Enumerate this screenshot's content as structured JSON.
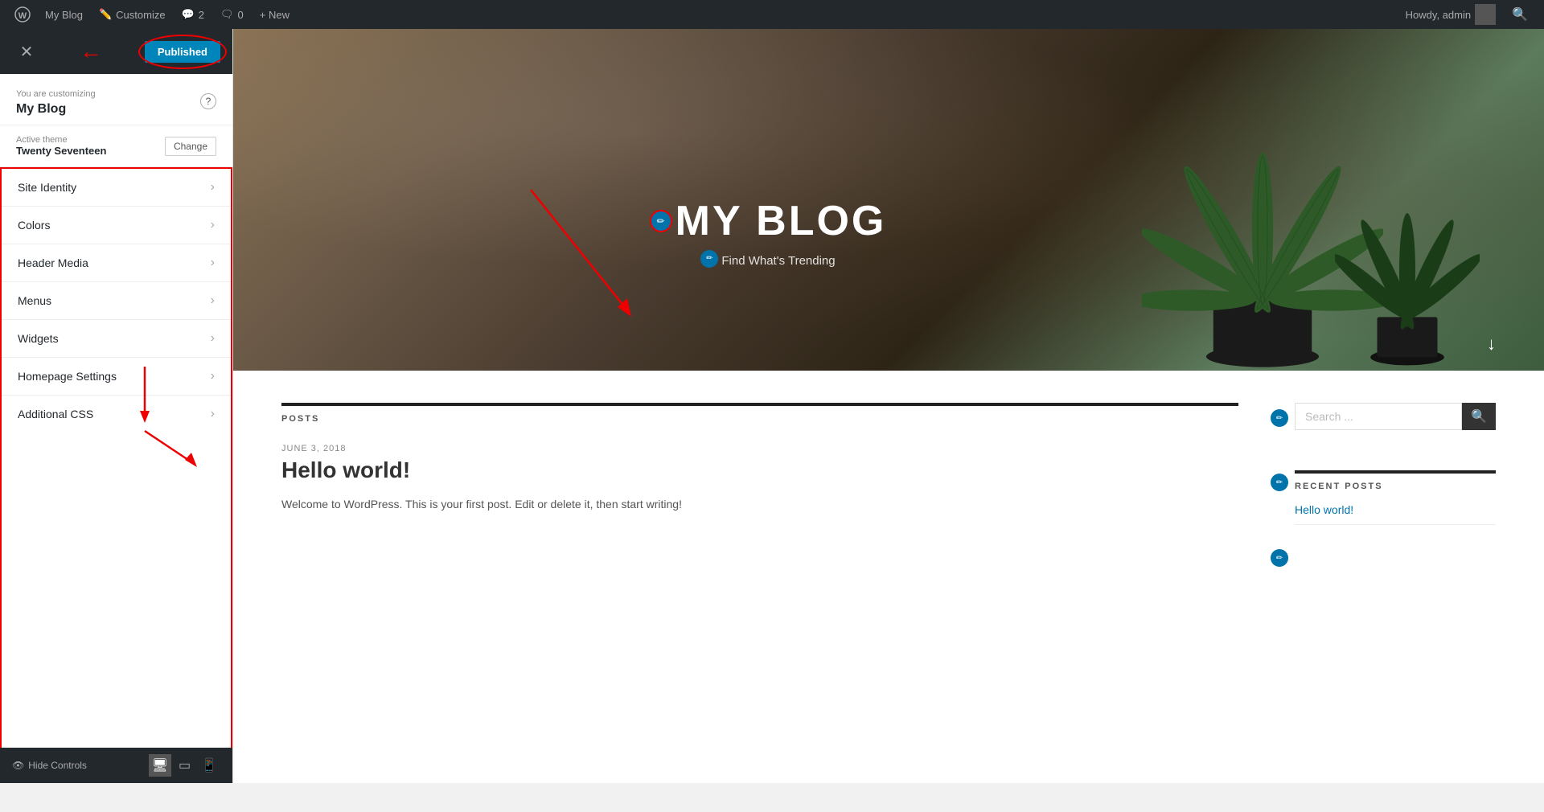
{
  "adminBar": {
    "wpLogo": "WP",
    "myBlog": "My Blog",
    "customize": "Customize",
    "comments": "2",
    "newItem": "+ New",
    "commentsCount": "0",
    "howdy": "Howdy, admin"
  },
  "customizer": {
    "youAreCustomizing": "You are customizing",
    "blogTitle": "My Blog",
    "activeThemeLabel": "Active theme",
    "themeName": "Twenty Seventeen",
    "changeBtn": "Change",
    "publishBtn": "Published",
    "menuItems": [
      {
        "label": "Site Identity",
        "id": "site-identity"
      },
      {
        "label": "Colors",
        "id": "colors"
      },
      {
        "label": "Header Media",
        "id": "header-media"
      },
      {
        "label": "Menus",
        "id": "menus"
      },
      {
        "label": "Widgets",
        "id": "widgets"
      },
      {
        "label": "Homepage Settings",
        "id": "homepage-settings"
      },
      {
        "label": "Additional CSS",
        "id": "additional-css"
      }
    ],
    "hideControls": "Hide Controls",
    "footerIcons": [
      "desktop",
      "tablet",
      "mobile"
    ]
  },
  "blog": {
    "heroTitle": "MY BLOG",
    "heroSubtitle": "Find What's Trending",
    "postsHeader": "POSTS",
    "post": {
      "date": "JUNE 3, 2018",
      "title": "Hello world!",
      "excerpt": "Welcome to WordPress. This is your first post. Edit or delete it, then start writing!"
    },
    "sidebar": {
      "searchPlaceholder": "Search ...",
      "searchLabel": "Search",
      "recentPostsTitle": "RECENT POSTS",
      "recentPosts": [
        "Hello world!"
      ]
    }
  }
}
